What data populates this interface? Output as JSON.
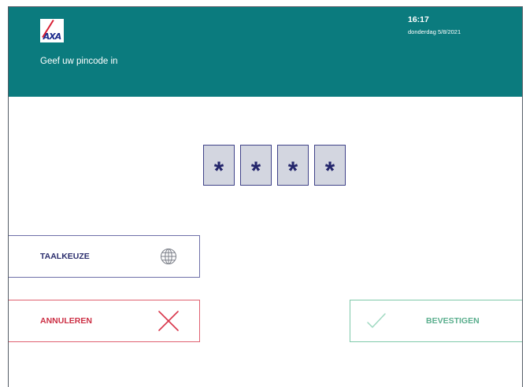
{
  "header": {
    "logo_text": "AXA",
    "prompt": "Geef uw pincode in",
    "time": "16:17",
    "date": "donderdag 5/8/2021"
  },
  "pin": {
    "digits": [
      "*",
      "*",
      "*",
      "*"
    ]
  },
  "buttons": {
    "language": {
      "label": "TAALKEUZE",
      "icon": "globe-icon"
    },
    "cancel": {
      "label": "ANNULEREN",
      "icon": "close-icon"
    },
    "confirm": {
      "label": "BEVESTIGEN",
      "icon": "checkmark-icon"
    }
  },
  "colors": {
    "header_bg": "#0b7b7e",
    "pin_box_bg": "#d3d6e0",
    "navy": "#23256b",
    "cancel_red": "#cc2f44",
    "confirm_green": "#5aae8d"
  }
}
